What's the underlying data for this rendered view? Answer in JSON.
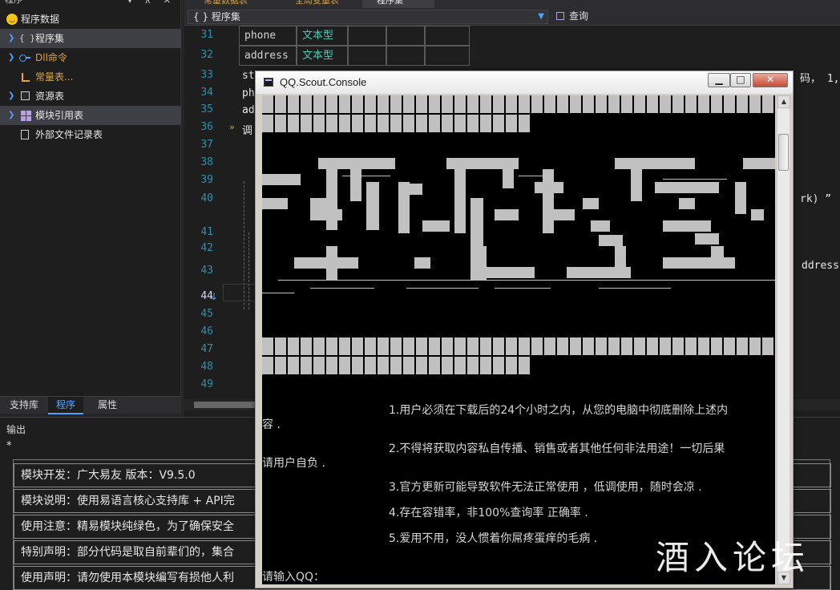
{
  "left_panel": {
    "title": "程序",
    "title_icons": "▾ ⊼ ✕",
    "tree": [
      {
        "label": "程序数据",
        "icon": "smiley-icon",
        "color": "#e6e6e6"
      },
      {
        "label": "程序集",
        "icon": "braces-icon",
        "color": "#e6e6e6",
        "selected": true
      },
      {
        "label": "Dll命令",
        "icon": "dll-icon",
        "color": "#d9a53a"
      },
      {
        "label": "常量表...",
        "icon": "constant-icon",
        "color": "#d9a53a"
      },
      {
        "label": "资源表",
        "icon": "resource-icon",
        "color": "#e6e6e6"
      },
      {
        "label": "模块引用表",
        "icon": "module-icon",
        "color": "#e6e6e6",
        "selected": true
      },
      {
        "label": "外部文件记录表",
        "icon": "file-icon",
        "color": "#e6e6e6"
      }
    ],
    "bottom_tabs": [
      "支持库",
      "程序",
      "属性"
    ]
  },
  "editor": {
    "doc_tabs": [
      "常量数据表",
      "全局变量表",
      "程序集"
    ],
    "nav": {
      "left": "{ } 程序集",
      "right": "查询"
    },
    "line_numbers": [
      "31",
      "32",
      "33",
      "34",
      "35",
      "36",
      "37",
      "38",
      "39",
      "40",
      "41",
      "42",
      "43",
      "44",
      "45",
      "46",
      "47",
      "48",
      "49"
    ],
    "table_rows": [
      {
        "name": "phone",
        "type": "文本型"
      },
      {
        "name": "address",
        "type": "文本型"
      }
    ],
    "code_fragments": {
      "l33": "st",
      "l34": "ph",
      "l35": "ad",
      "l36": "调",
      "l33_right": "码， 1,",
      "l40_right": "rk) ”",
      "l43_right": "ddress"
    }
  },
  "output": {
    "title": "输出",
    "star": "*",
    "rows": [
      "模块开发：广大易友      版本：V9.5.0",
      "模块说明：使用易语言核心支持库 + API完",
      "使用注意：精易模块纯绿色，为了确保安全",
      "特别声明：部分代码是取自前辈们的，集合",
      "使用声明：请勿使用本模块编写有损他人利"
    ]
  },
  "console": {
    "title": "QQ.Scout.Console",
    "buttons": {
      "minimize": "▁",
      "maximize": "□",
      "close": "✕"
    },
    "notices": [
      "1.用户必须在下载后的24个小时之内，从您的电脑中彻底删除上述内",
      "容 .",
      "2.不得将获取内容私自传播、销售或者其他任何非法用途！一切后果",
      "请用户自负 .",
      "3.官方更新可能导致软件无法正常使用 ，低调使用，随时会凉 .",
      "4.存在容错率，非100%查询率 正确率 .",
      "5.爱用不用，没人惯着你屌疼蛋痒的毛病 ."
    ],
    "prompt": "请输入QQ："
  },
  "watermark": "酒入论坛"
}
